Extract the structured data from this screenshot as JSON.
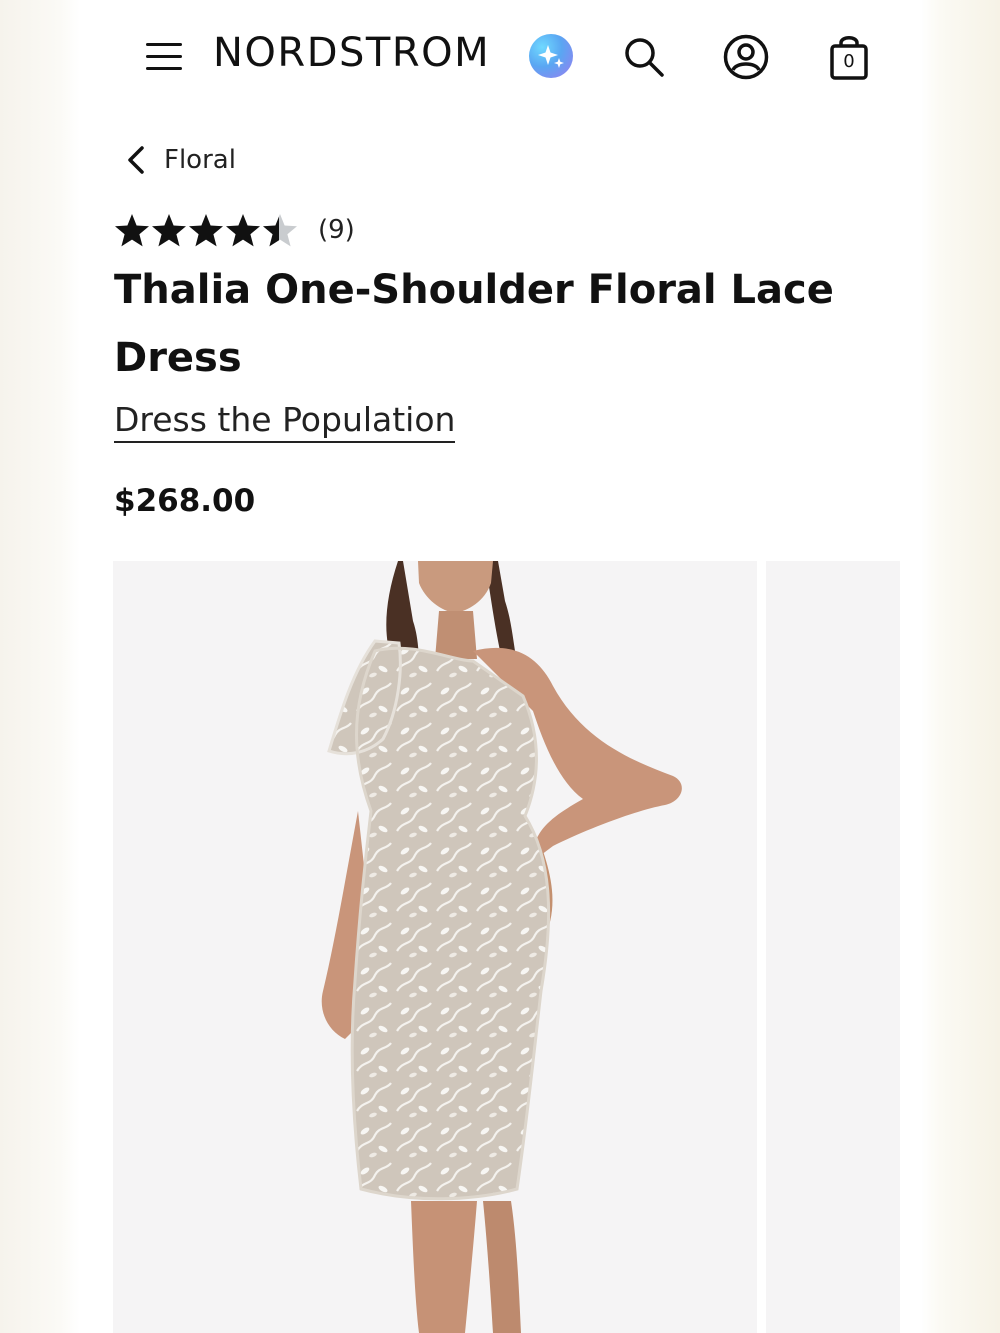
{
  "header": {
    "logo": "NORDSTROM",
    "bag_count": "0",
    "icons": [
      "menu-icon",
      "sparkle-ai-icon",
      "search-icon",
      "account-icon",
      "shopping-bag-icon"
    ]
  },
  "breadcrumb": {
    "label": "Floral"
  },
  "rating": {
    "stars": 4.5,
    "max": 5,
    "count_label": "(9)"
  },
  "product": {
    "title": "Thalia One-Shoulder Floral Lace Dress",
    "brand": "Dress the Population",
    "price": "$268.00"
  },
  "gallery": {
    "main_image": "model-in-one-shoulder-floral-lace-dress",
    "next_image": "next-product-image-preview"
  },
  "colors": {
    "text": "#111111",
    "image_background": "#f5f4f5",
    "star_filled": "#111111",
    "star_empty": "#c9cccf",
    "ai_gradient_start": "#6fd9ff",
    "ai_gradient_end": "#9b7cf0"
  }
}
